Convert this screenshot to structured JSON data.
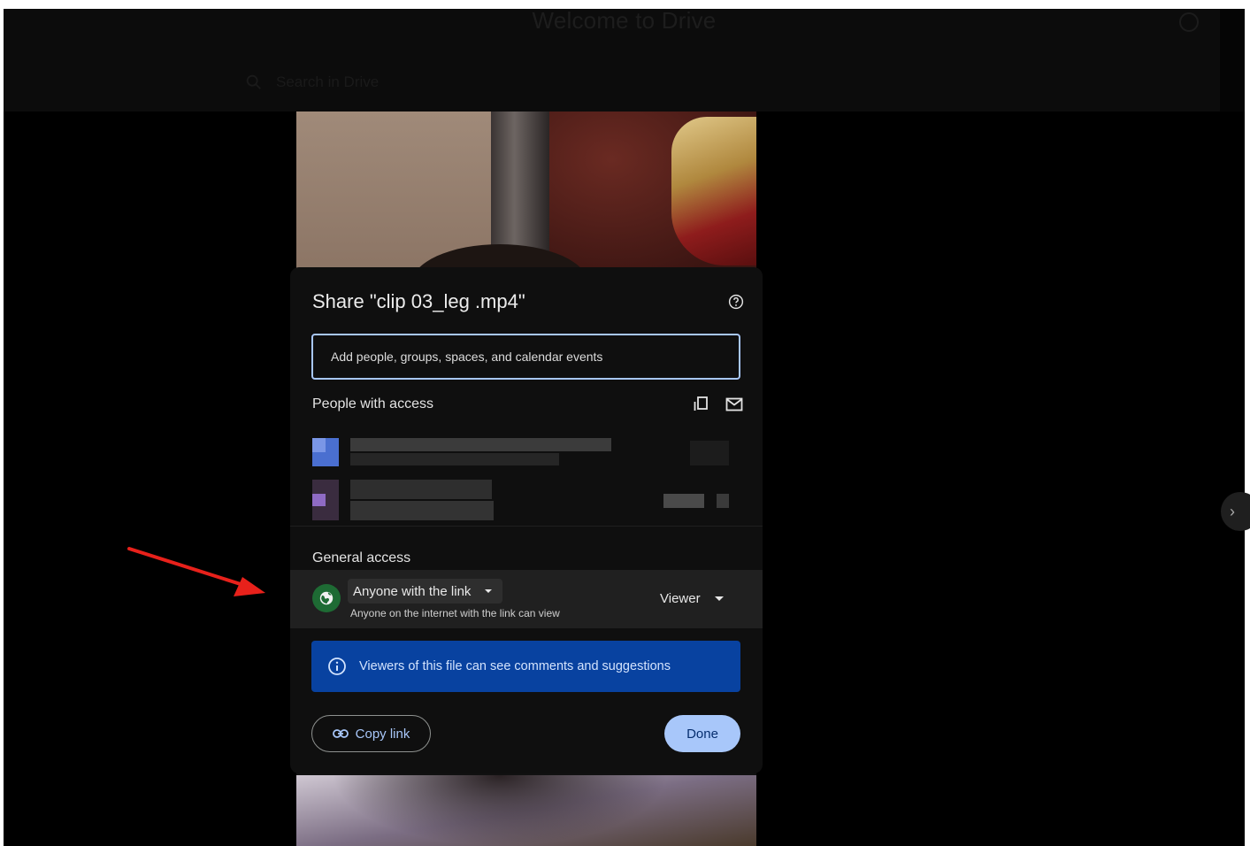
{
  "topbar": {
    "title": "Welcome to Drive",
    "search_placeholder": "Search in Drive"
  },
  "dialog": {
    "title": "Share \"clip 03_leg .mp4\"",
    "add_people_placeholder": "Add people, groups, spaces, and calendar events",
    "people_section_title": "People with access",
    "general_access_title": "General access",
    "access_option": "Anyone with the link",
    "access_description": "Anyone on the internet with the link can view",
    "role": "Viewer",
    "info_text": "Viewers of this file can see comments and suggestions",
    "copy_link_label": "Copy link",
    "done_label": "Done"
  },
  "icons": {
    "help": "help-icon",
    "copy_emails": "copy-emails-icon",
    "email": "email-icon",
    "globe": "globe-icon",
    "info": "info-icon",
    "link": "link-icon",
    "next": "chevron-right-icon"
  },
  "colors": {
    "input_border": "#a8c7fa",
    "info_banner": "#0842a0",
    "primary_button": "#a8c7fa",
    "globe_badge": "#1e6b34",
    "arrow": "#e8211b"
  }
}
